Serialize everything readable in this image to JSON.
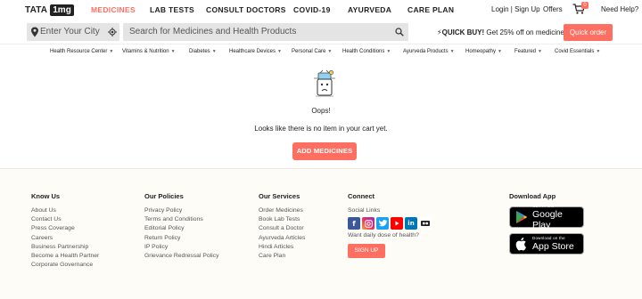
{
  "header": {
    "logo_tata": "TATA",
    "logo_1mg": "1mg",
    "nav": [
      "MEDICINES",
      "LAB TESTS",
      "CONSULT DOCTORS",
      "COVID-19",
      "AYURVEDA",
      "CARE PLAN"
    ],
    "active_nav": "MEDICINES",
    "login": "Login | Sign Up",
    "offers": "Offers",
    "cart_count": "0",
    "help": "Need Help?"
  },
  "search": {
    "city_placeholder": "Enter Your City",
    "search_placeholder": "Search for Medicines and Health Products",
    "quick_buy_bold": "QUICK BUY!",
    "quick_buy_text": " Get 25% off on medicines*",
    "quick_order": "Quick order"
  },
  "categories": [
    "Health Resource Center",
    "Vitamins & Nutrition",
    "Diabetes",
    "Healthcare Devices",
    "Personal Care",
    "Health Conditions",
    "Ayurveda Products",
    "Homeopathy",
    "Featured",
    "Covid Essentials"
  ],
  "cart": {
    "oops": "Oops!",
    "message": "Looks like there is no item in your cart yet.",
    "add_button": "ADD MEDICINES"
  },
  "footer": {
    "know_us": {
      "title": "Know Us",
      "links": [
        "About Us",
        "Contact Us",
        "Press Coverage",
        "Careers",
        "Business Partnership",
        "Become a Health Partner",
        "Corporate Governance"
      ]
    },
    "policies": {
      "title": "Our Policies",
      "links": [
        "Privacy Policy",
        "Terms and Conditions",
        "Editorial Policy",
        "Return Policy",
        "IP Policy",
        "Grievance Redressal Policy"
      ]
    },
    "services": {
      "title": "Our Services",
      "links": [
        "Order Medicines",
        "Book Lab Tests",
        "Consult a Doctor",
        "Ayurveda Articles",
        "Hindi Articles",
        "Care Plan"
      ]
    },
    "connect": {
      "title": "Connect",
      "social_label": "Social Links",
      "social": [
        "facebook",
        "instagram",
        "twitter",
        "youtube",
        "linkedin",
        "flickr"
      ],
      "newsletter": "Want daily dose of health?",
      "signup": "SIGN UP"
    },
    "download": {
      "title": "Download App",
      "google_small": "GET IT ON",
      "google_big": "Google Play",
      "apple_small": "Download on the",
      "apple_big": "App Store"
    }
  },
  "colors": {
    "accent": "#ff6f61",
    "footer_bg": "#fdfcf7",
    "search_bg": "#e4e4e4"
  }
}
